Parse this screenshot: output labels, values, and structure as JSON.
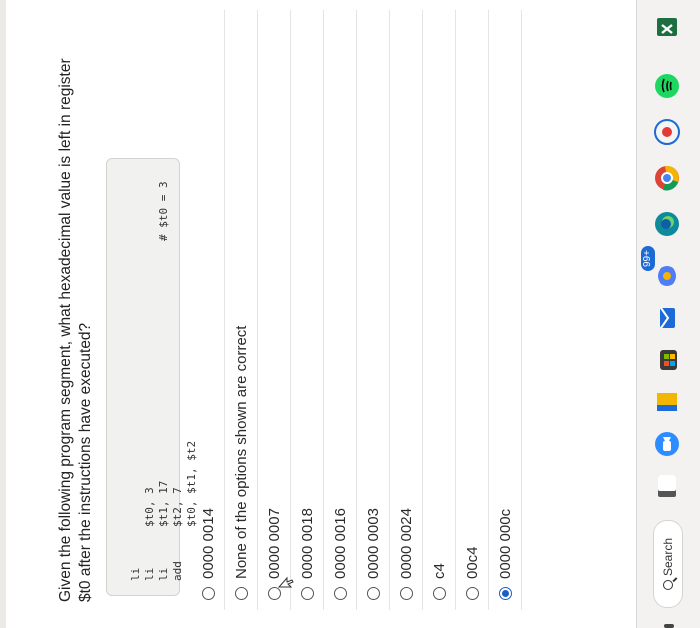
{
  "question": {
    "text": "Given the following program segment, what hexadecimal value is left in register $t0 after the instructions have executed?"
  },
  "code": [
    {
      "op": "li",
      "args": "$t0, 3",
      "comment": "# $t0 = 3"
    },
    {
      "op": "li",
      "args": "$t1, 17",
      "comment": ""
    },
    {
      "op": "li",
      "args": "$t2, 7",
      "comment": ""
    },
    {
      "op": "add",
      "args": "$t0, $t1, $t2",
      "comment": ""
    }
  ],
  "options": [
    {
      "label": "0000 0014",
      "selected": false
    },
    {
      "label": "None of the options shown are correct",
      "selected": false
    },
    {
      "label": "0000 0007",
      "selected": false
    },
    {
      "label": "0000 0018",
      "selected": false
    },
    {
      "label": "0000 0016",
      "selected": false
    },
    {
      "label": "0000 0003",
      "selected": false
    },
    {
      "label": "0000 0024",
      "selected": false
    },
    {
      "label": "c4",
      "selected": false
    },
    {
      "label": "00c4",
      "selected": false
    },
    {
      "label": "0000 000c",
      "selected": true
    }
  ],
  "taskbar": {
    "search_label": "Search",
    "mail_badge": "99+",
    "icons": [
      "windows-start-icon",
      "search-icon",
      "file-explorer-icon",
      "zoom-icon",
      "files-icon",
      "store-icon",
      "mail-icon",
      "copilot-icon",
      "edge-icon",
      "chrome-icon",
      "opera-icon",
      "spotify-icon",
      "excel-icon"
    ]
  },
  "colors": {
    "accent": "#1b5fc2",
    "code_background": "#f1f1ef",
    "taskbar": "#f3f2f0"
  }
}
